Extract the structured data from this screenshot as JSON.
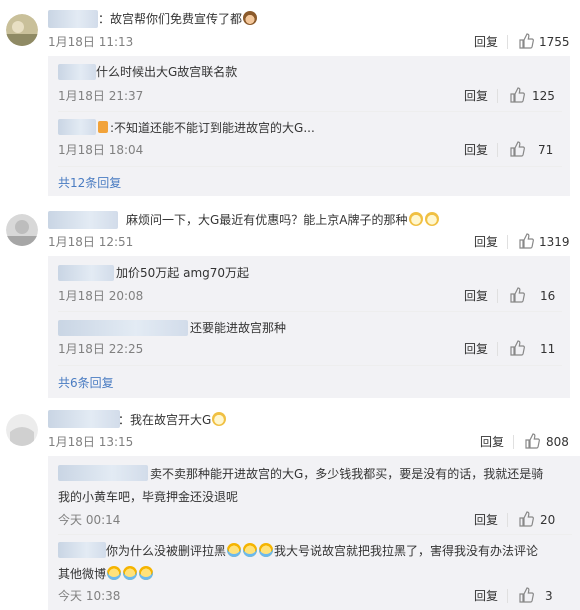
{
  "reply_label": "回复",
  "threads": [
    {
      "comment": {
        "text": "：故宫帮你们免费宣传了都",
        "emoji": "monkey-emoji",
        "time": "1月18日 11:13",
        "likes": "1755"
      },
      "replies": [
        {
          "text": "什么时候出大G故宫联名款",
          "time": "1月18日 21:37",
          "likes": "125"
        },
        {
          "text": ":不知道还能不能订到能进故宫的大G...",
          "time": "1月18日 18:04",
          "likes": "71"
        }
      ],
      "more": "共12条回复"
    },
    {
      "comment": {
        "text": "麻烦问一下，大G最近有优惠吗？能上京A牌子的那种",
        "emoji": "cat-emoji",
        "time": "1月18日 12:51",
        "likes": "1319"
      },
      "replies": [
        {
          "text": "加价50万起 amg70万起",
          "time": "1月18日 20:08",
          "likes": "16"
        },
        {
          "text": "还要能进故宫那种",
          "time": "1月18日 22:25",
          "likes": "11"
        }
      ],
      "more": "共6条回复"
    },
    {
      "comment": {
        "text": "：我在故宫开大G",
        "emoji": "cat-emoji",
        "time": "1月18日 13:15",
        "likes": "808"
      },
      "replies": [
        {
          "line1": "卖不卖那种能开进故宫的大G，多少钱我都买，要是没有的话，我就还是骑",
          "line2": "我的小黄车吧，毕竟押金还没退呢",
          "time": "今天 00:14",
          "likes": "20"
        },
        {
          "line1a": "你为什么没被删评拉黑",
          "line1b": "我大号说故宫就把我拉黑了，害得我没有办法评论",
          "line2": "其他微博",
          "time": "今天 10:38",
          "likes": "3"
        }
      ]
    }
  ]
}
